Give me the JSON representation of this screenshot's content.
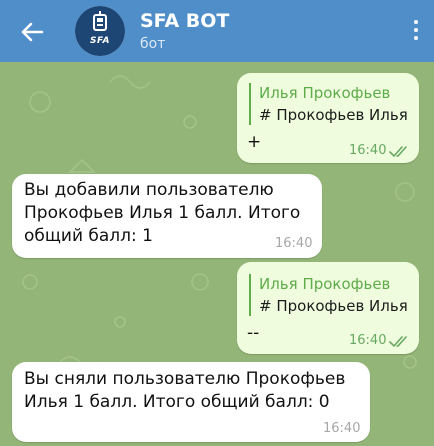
{
  "header": {
    "title": "SFA BOT",
    "subtitle": "бот",
    "avatar_text": "SFA"
  },
  "colors": {
    "header": "#4f8ec9",
    "chat_background": "#93b577",
    "outgoing_bubble": "#effdde",
    "incoming_bubble": "#ffffff",
    "quote_accent": "#5fac4b"
  },
  "messages": [
    {
      "direction": "outgoing",
      "quote_name": "Илья Прокофьев",
      "quote_text": "# Прокофьев Илья",
      "text": "+",
      "time": "16:40",
      "status": "read"
    },
    {
      "direction": "incoming",
      "lines": [
        "Вы добавили пользователю",
        "Прокофьев Илья 1 балл. Итого",
        "общий балл: 1"
      ],
      "time": "16:40"
    },
    {
      "direction": "outgoing",
      "quote_name": "Илья Прокофьев",
      "quote_text": "# Прокофьев Илья",
      "text": "--",
      "time": "16:40",
      "status": "read"
    },
    {
      "direction": "incoming",
      "lines": [
        "Вы сняли пользователю Прокофьев",
        "Илья 1 балл. Итого общий балл: 0"
      ],
      "time": "16:40"
    }
  ]
}
